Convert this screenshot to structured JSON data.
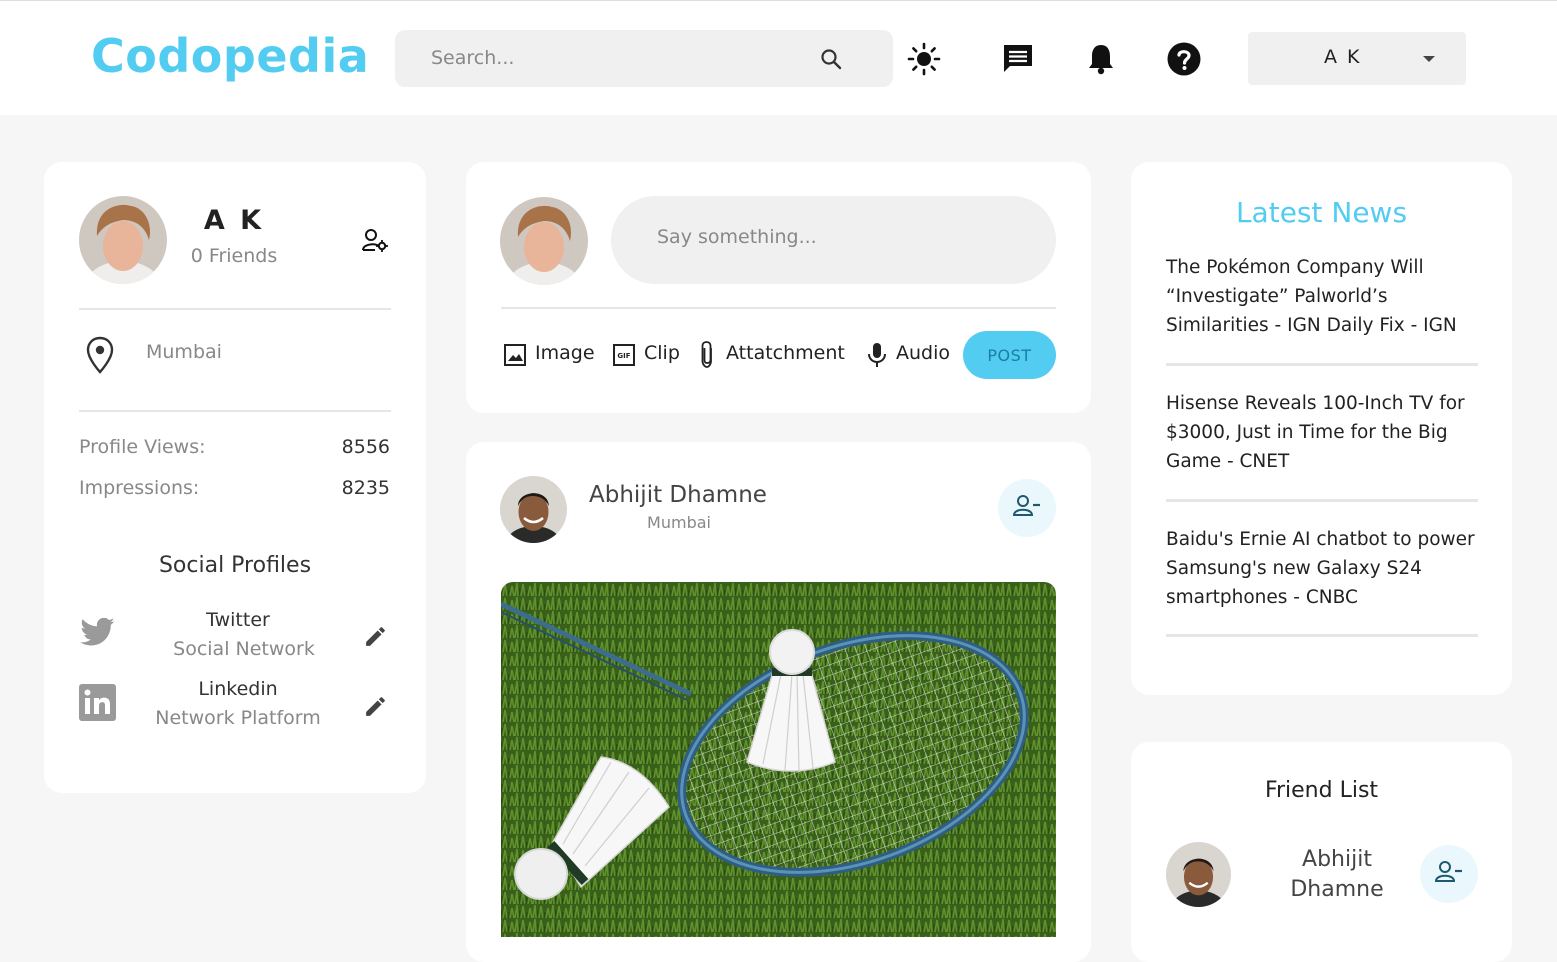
{
  "header": {
    "logo": "Codopedia",
    "search_placeholder": "Search...",
    "user_name": "A K"
  },
  "profile": {
    "name": "A K",
    "friends": "0 Friends",
    "location": "Mumbai",
    "profile_views_label": "Profile Views:",
    "profile_views_value": "8556",
    "impressions_label": "Impressions:",
    "impressions_value": "8235",
    "social_title": "Social Profiles",
    "socials": [
      {
        "name": "Twitter",
        "type": "Social Network"
      },
      {
        "name": "Linkedin",
        "type": "Network Platform"
      }
    ]
  },
  "composer": {
    "placeholder": "Say something...",
    "actions": [
      "Image",
      "Clip",
      "Attatchment",
      "Audio"
    ],
    "post_label": "POST"
  },
  "post": {
    "author": "Abhijit Dhamne",
    "location": "Mumbai"
  },
  "news": {
    "title": "Latest News",
    "items": [
      "The Pokémon Company Will “Investigate” Palworld’s Similarities - IGN Daily Fix - IGN",
      "Hisense Reveals 100-Inch TV for $3000, Just in Time for the Big Game - CNET",
      "Baidu's Ernie AI chatbot to power Samsung's new Galaxy S24 smartphones - CNBC"
    ]
  },
  "friends": {
    "title": "Friend List",
    "list": [
      {
        "first": "Abhijit",
        "last": "Dhamne"
      }
    ]
  },
  "colors": {
    "accent": "#52ccf0",
    "background": "#f6f6f6"
  }
}
